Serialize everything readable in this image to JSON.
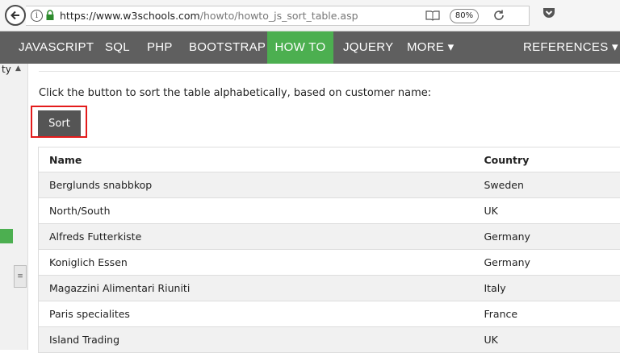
{
  "browser": {
    "url_host": "https://www.w3schools.com",
    "url_path": "/howto/howto_js_sort_table.asp",
    "zoom": "80%"
  },
  "nav": {
    "items": [
      {
        "label": "JAVASCRIPT",
        "active": false
      },
      {
        "label": "SQL",
        "active": false
      },
      {
        "label": "PHP",
        "active": false
      },
      {
        "label": "BOOTSTRAP",
        "active": false
      },
      {
        "label": "HOW TO",
        "active": true
      },
      {
        "label": "JQUERY",
        "active": false
      },
      {
        "label": "MORE ▾",
        "active": false
      },
      {
        "label": "REFERENCES ▾",
        "active": false
      }
    ],
    "active_color": "#4caf50",
    "bg_color": "#5f5f5f"
  },
  "sidebar": {
    "fragment": "ty"
  },
  "main": {
    "instruction": "Click the button to sort the table alphabetically, based on customer name:",
    "sort_label": "Sort",
    "table": {
      "headers": [
        "Name",
        "Country"
      ],
      "rows": [
        [
          "Berglunds snabbkop",
          "Sweden"
        ],
        [
          "North/South",
          "UK"
        ],
        [
          "Alfreds Futterkiste",
          "Germany"
        ],
        [
          "Koniglich Essen",
          "Germany"
        ],
        [
          "Magazzini Alimentari Riuniti",
          "Italy"
        ],
        [
          "Paris specialites",
          "France"
        ],
        [
          "Island Trading",
          "UK"
        ]
      ]
    }
  }
}
